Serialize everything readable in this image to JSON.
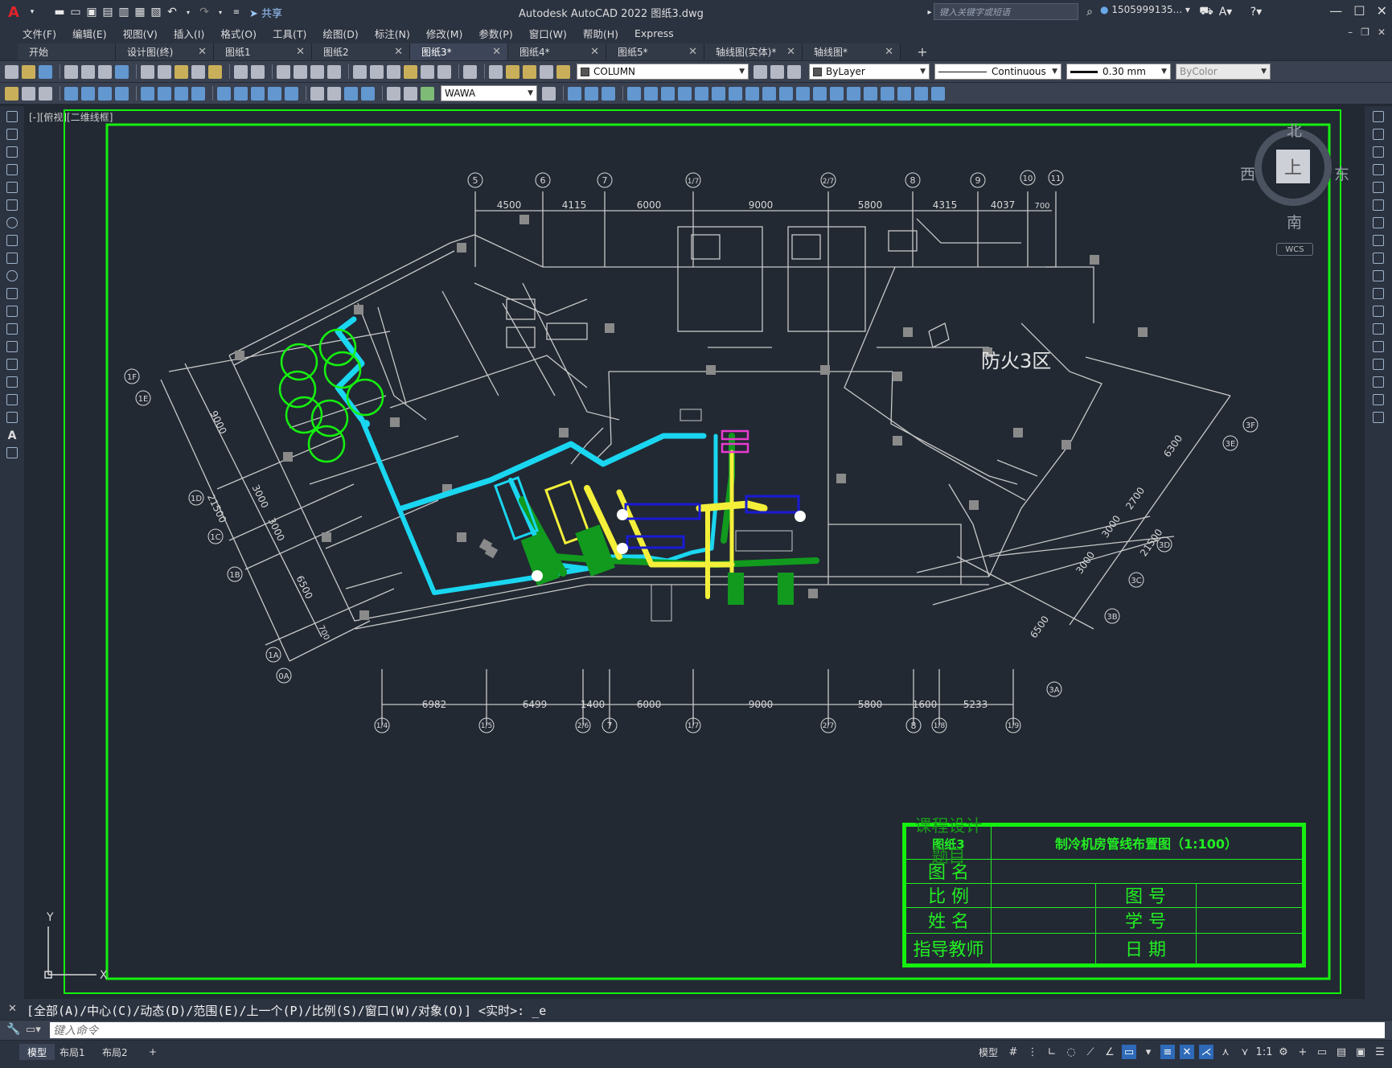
{
  "app": {
    "title": "Autodesk AutoCAD 2022    图纸3.dwg",
    "share_label": "共享",
    "search_placeholder": "键入关键字或短语",
    "user_id": "1505999135... ▾"
  },
  "menu": {
    "items": [
      "文件(F)",
      "编辑(E)",
      "视图(V)",
      "插入(I)",
      "格式(O)",
      "工具(T)",
      "绘图(D)",
      "标注(N)",
      "修改(M)",
      "参数(P)",
      "窗口(W)",
      "帮助(H)",
      "Express"
    ]
  },
  "tabs": {
    "items": [
      {
        "label": "开始",
        "active": false
      },
      {
        "label": "设计图(终)",
        "active": false
      },
      {
        "label": "图纸1",
        "active": false
      },
      {
        "label": "图纸2",
        "active": false
      },
      {
        "label": "图纸3*",
        "active": true
      },
      {
        "label": "图纸4*",
        "active": false
      },
      {
        "label": "图纸5*",
        "active": false
      },
      {
        "label": "轴线图(实体)*",
        "active": false
      },
      {
        "label": "轴线图*",
        "active": false
      }
    ],
    "add_label": "+"
  },
  "properties": {
    "layer": "COLUMN",
    "color": "ByLayer",
    "linetype": "Continuous",
    "lineweight": "0.30 mm",
    "plotstyle": "ByColor",
    "dimstyle": "WAWA"
  },
  "viewport": {
    "label": "[-][俯视][二维线框]"
  },
  "viewcube": {
    "north": "北",
    "south": "南",
    "west": "西",
    "east": "东",
    "face": "上",
    "wcs": "WCS"
  },
  "drawing": {
    "zone_label": "防火3区",
    "top_axes": [
      "5",
      "6",
      "7",
      "1/7",
      "2/7",
      "8",
      "9",
      "10",
      "11"
    ],
    "top_dims": [
      "4500",
      "4115",
      "6000",
      "9000",
      "5800",
      "4315",
      "4037",
      "700"
    ],
    "bottom_axes": [
      "1/4",
      "1/5",
      "2/6",
      "7",
      "1/7",
      "2/7",
      "8",
      "1/8",
      "1/9"
    ],
    "bottom_dims": [
      "6982",
      "6499",
      "1400",
      "6000",
      "9000",
      "5800",
      "1600",
      "5233"
    ],
    "left_axes": [
      "1F",
      "1E",
      "1D",
      "1C",
      "1B",
      "1A",
      "0A"
    ],
    "left_dims": [
      "9000",
      "21500",
      "3000",
      "3000",
      "6500",
      "700"
    ],
    "right_axes": [
      "3F",
      "3E",
      "3D",
      "3C",
      "3B",
      "3A"
    ],
    "right_dims": [
      "6300",
      "2700",
      "3000",
      "21500",
      "3000",
      "6500"
    ]
  },
  "title_block": {
    "course": "课程设计",
    "topic": "题目",
    "sheet_no": "图纸3",
    "drawing_title": "制冷机房管线布置图（1:100）",
    "name_label": "图 名",
    "scale_label": "比 例",
    "drawing_no_label": "图 号",
    "student_name_label": "姓 名",
    "student_no_label": "学 号",
    "advisor_label": "指导教师",
    "date_label": "日 期"
  },
  "command": {
    "history": "[全部(A)/中心(C)/动态(D)/范围(E)/上一个(P)/比例(S)/窗口(W)/对象(O)] <实时>: _e",
    "input_placeholder": "键入命令"
  },
  "status": {
    "layouts": [
      {
        "label": "模型",
        "active": true
      },
      {
        "label": "布局1",
        "active": false
      },
      {
        "label": "布局2",
        "active": false
      }
    ],
    "model_label": "模型",
    "scale": "1:1"
  },
  "colors": {
    "frame": "#15f00f",
    "cyan_pipe": "#1ad6f0",
    "yellow_pipe": "#f4f03a",
    "green_pipe": "#119a1e",
    "blue_equip": "#1a1ad6",
    "magenta_equip": "#e83ad0",
    "wall": "#c8c8c8"
  }
}
